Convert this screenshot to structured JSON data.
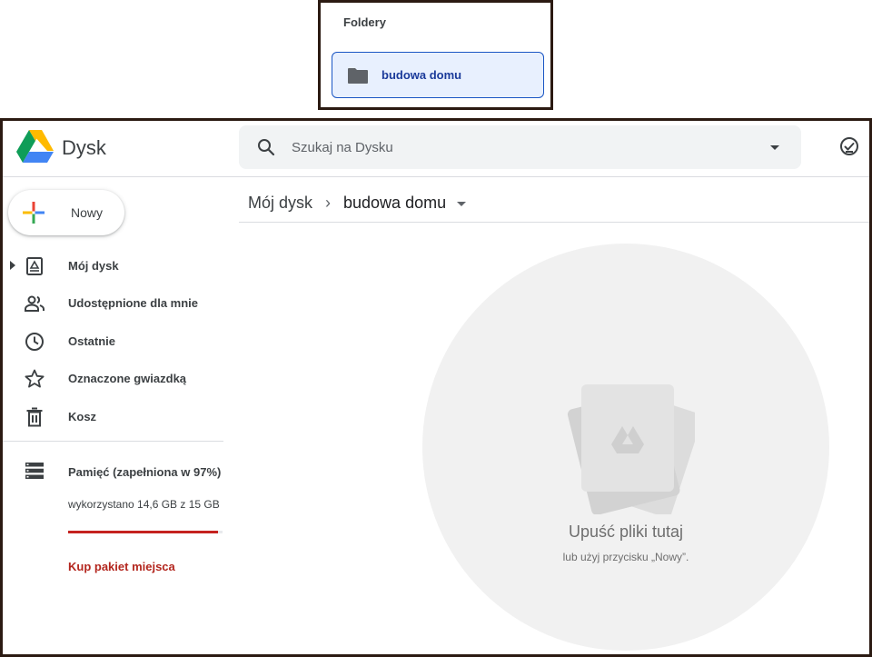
{
  "inset": {
    "title": "Foldery",
    "folder_label": "budowa domu"
  },
  "header": {
    "app_name": "Dysk",
    "search_placeholder": "Szukaj na Dysku"
  },
  "sidebar": {
    "new_button": "Nowy",
    "items": [
      {
        "label": "Mój dysk",
        "icon": "my-drive-icon"
      },
      {
        "label": "Udostępnione dla mnie",
        "icon": "shared-people-icon"
      },
      {
        "label": "Ostatnie",
        "icon": "clock-icon"
      },
      {
        "label": "Oznaczone gwiazdką",
        "icon": "star-icon"
      },
      {
        "label": "Kosz",
        "icon": "trash-icon"
      }
    ],
    "storage": {
      "label": "Pamięć (zapełniona w 97%)",
      "usage": "wykorzystano 14,6 GB z 15 GB",
      "used_fraction": 0.97,
      "buy_label": "Kup pakiet miejsca"
    }
  },
  "breadcrumb": {
    "root": "Mój dysk",
    "current": "budowa domu"
  },
  "drop_zone": {
    "title": "Upuść pliki tutaj",
    "subtitle": "lub użyj przycisku „Nowy”."
  },
  "colors": {
    "accent_blue": "#1a73e8",
    "storage_warning": "#c5221f",
    "selected_folder_bg": "#e8f0fe"
  }
}
